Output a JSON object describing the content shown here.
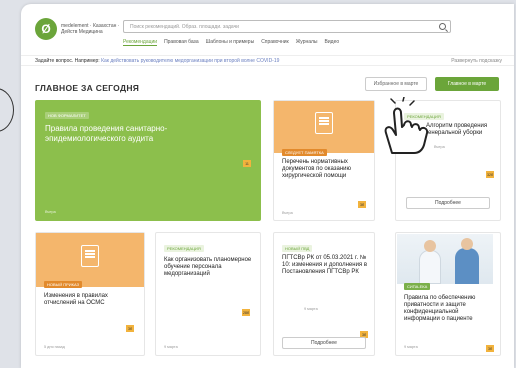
{
  "logo": {
    "text": "medelement · Казахстан · Дeйcтв Медицина"
  },
  "search": {
    "placeholder": "Поиск рекомендаций. Образ. площади. задачи"
  },
  "nav": [
    "Рекомендации",
    "Правовая база",
    "Шаблоны и примеры",
    "Справочник",
    "Журналы",
    "Видео"
  ],
  "question": {
    "label": "Задайте вопрос. Например:",
    "link": "Как действовать руководителю медорганизации при второй волне COVID-19",
    "hint": "Развернуть подсказку"
  },
  "section_title": "ГЛАВНОЕ ЗА СЕГОДНЯ",
  "buttons": {
    "favorites": "Избранное в марте",
    "main": "Главное в марте"
  },
  "cards": [
    {
      "tag": "НОВ ФОРМАЛИТЕТ",
      "title": "Правила проведения санитарно-эпидемиологического аудита",
      "badge": "11",
      "date": "Вчера"
    },
    {
      "tag": "СЛЕДУЕТ ПАМЯТКА",
      "title": "Перечень нормативных документов по оказанию хирургической помощи",
      "badge": "3б",
      "date": "Вчера"
    },
    {
      "tag": "РЕКОМЕНДАЦИЯ",
      "title": "Алгоритм проведения генеральной уборки",
      "badge": "32б",
      "date": "Вчера",
      "button": "Подробнее"
    },
    {
      "tag": "НОВЫЙ ПРИКАЗ",
      "title": "Изменения в правилах отчислений на ОСМС",
      "badge": "3б",
      "date": "5 дня назад"
    },
    {
      "tag": "РЕКОМЕНДАЦИЯ",
      "title": "Как организовать планомерное обучение персонала медорганизаций",
      "badge": "28б",
      "date": "9 марта"
    },
    {
      "tag": "НОВЫЙ ПВД",
      "title": "ПГТСВр РК от 05.03.2021 г. № 10: изменения и дополнения в Постановления ПГТСВр РК",
      "badge": "3б",
      "date": "9 марта",
      "button": "Подробнее"
    },
    {
      "tag": "СИПА-ЕКА",
      "title": "Правила по обеспечению приватности и защите конфиденциальной информации о пациенте",
      "badge": "3б",
      "date": "9 марта"
    }
  ]
}
